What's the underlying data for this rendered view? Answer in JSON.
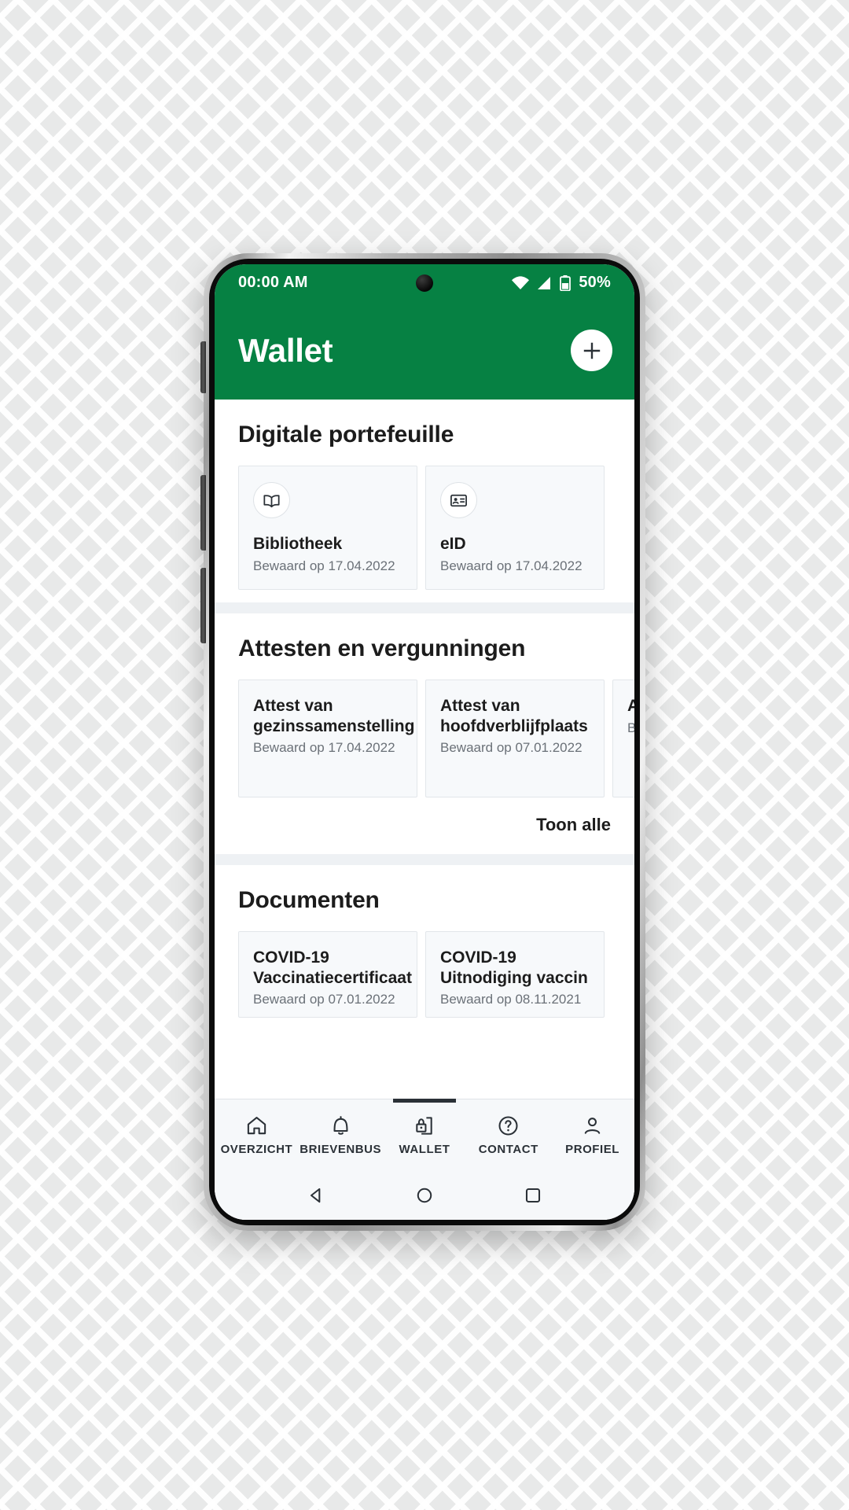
{
  "status_bar": {
    "time": "00:00 AM",
    "wifi_icon": "wifi-icon",
    "signal_icon": "cellular-signal-icon",
    "battery_icon": "battery-icon",
    "battery_percent": "50%"
  },
  "app_bar": {
    "title": "Wallet",
    "add_button": "+",
    "add_icon": "plus-icon",
    "background_color": "#068143"
  },
  "sections": [
    {
      "title": "Digitale portefeuille",
      "cards": [
        {
          "icon": "book-icon",
          "title": "Bibliotheek",
          "subtitle": "Bewaard op 17.04.2022"
        },
        {
          "icon": "id-card-icon",
          "title": "eID",
          "subtitle": "Bewaard op 17.04.2022"
        }
      ]
    },
    {
      "title": "Attesten en vergunningen",
      "show_all": "Toon alle",
      "cards": [
        {
          "title": "Attest van gezinssamenstelling",
          "subtitle": "Bewaard op 17.04.2022"
        },
        {
          "title": "Attest van hoofdverblijfplaats",
          "subtitle": "Bewaard op  07.01.2022"
        },
        {
          "title": "Attest",
          "subtitle": "Bewaa"
        }
      ]
    },
    {
      "title": "Documenten",
      "cards": [
        {
          "title": "COVID-19 Vaccinatiecertificaat",
          "subtitle": "Bewaard op  07.01.2022"
        },
        {
          "title": "COVID-19 Uitnodiging vaccin",
          "subtitle": "Bewaard op 08.11.2021"
        }
      ]
    }
  ],
  "bottom_nav": {
    "items": [
      {
        "label": "OVERZICHT",
        "icon": "home-icon",
        "active": false
      },
      {
        "label": "BRIEVENBUS",
        "icon": "bell-icon",
        "active": false
      },
      {
        "label": "WALLET",
        "icon": "locked-document-icon",
        "active": true
      },
      {
        "label": "CONTACT",
        "icon": "question-circle-icon",
        "active": false
      },
      {
        "label": "PROFIEL",
        "icon": "person-icon",
        "active": false
      }
    ]
  },
  "system_nav": {
    "back_icon": "back-triangle-icon",
    "home_icon": "home-circle-icon",
    "recents_icon": "recents-square-icon"
  }
}
